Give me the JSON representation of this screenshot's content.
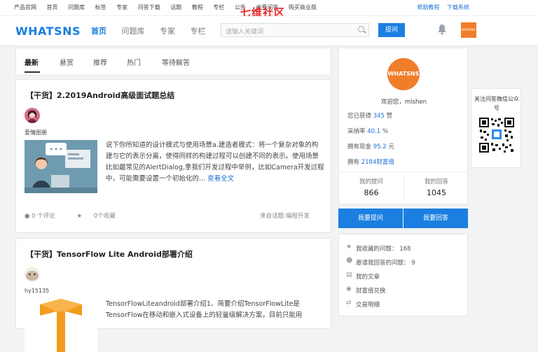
{
  "topbar": {
    "links": [
      "产品官网",
      "首页",
      "问题库",
      "标签",
      "专家",
      "问答下载",
      "话题",
      "教程",
      "专栏",
      "公告",
      "收费问答",
      "购买商业版"
    ],
    "overlay_brand": "七维社区",
    "right_links": [
      "帮助教程",
      "下载系统"
    ]
  },
  "header": {
    "logo": "WHATSNS",
    "nav": [
      "首页",
      "问题库",
      "专家",
      "专栏"
    ],
    "search_placeholder": "请输入关键词",
    "ask_button": "提问",
    "avatar_text": "WHATSNS"
  },
  "tabs": [
    "最新",
    "悬赏",
    "推荐",
    "热门",
    "等待解答"
  ],
  "posts": [
    {
      "title": "【干货】2.2019Android高级面试题总结",
      "author": "爱情图册",
      "excerpt": "说下你所知道的设计模式与使用场景a.建造者模式：将一个复杂对象的构建与它的表示分离，使得同样的构建过程可以创建不同的表示。使用场景比如最常见的AlertDialog,拿我们开发过程中举例，比如Camera开发过程中，可能需要设置一个初始化的...",
      "more": "查看全文",
      "comments": "0 个评论",
      "favorites": "0个收藏",
      "topic": "来自话题:编程开发"
    },
    {
      "title": "【干货】TensorFlow Lite Android部署介绍",
      "author": "hy15135",
      "excerpt": "TensorFlowLiteandroid部署介绍1、简要介绍TensorFlowLite是TensorFlow在移动和嵌入式设备上的轻量级解决方案，目前只能用"
    }
  ],
  "profile": {
    "avatar_text": "WHATSNS",
    "welcome": "欢迎您，mishen",
    "stats": [
      {
        "label": "您已获得",
        "value": "345",
        "unit": "赞"
      },
      {
        "label": "采纳率",
        "value": "40.1",
        "unit": "%"
      },
      {
        "label": "拥有现金",
        "value": "95.2",
        "unit": "元"
      },
      {
        "label": "拥有",
        "value": "2184财富值",
        "unit": ""
      }
    ],
    "my_questions_label": "我的提问",
    "my_questions": "866",
    "my_answers_label": "我的回答",
    "my_answers": "1045"
  },
  "actions": {
    "ask": "我要提问",
    "answer": "我要回答"
  },
  "quick_links": [
    {
      "icon": "star-icon",
      "label": "我收藏的问题：",
      "value": "168"
    },
    {
      "icon": "user-icon",
      "label": "邀请我回答的问题：",
      "value": "9"
    },
    {
      "icon": "document-icon",
      "label": "我的文章",
      "value": ""
    },
    {
      "icon": "database-icon",
      "label": "财富值兑换",
      "value": ""
    },
    {
      "icon": "exchange-icon",
      "label": "交易明细",
      "value": ""
    }
  ],
  "qr": {
    "caption": "关注问答微信公众号"
  }
}
